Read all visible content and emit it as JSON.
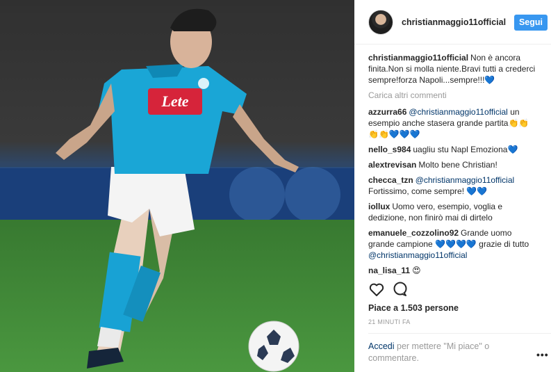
{
  "post": {
    "username": "christianmaggio11official",
    "follow_label": "Segui",
    "caption": {
      "user": "christianmaggio11official",
      "text": "Non è ancora finita.Non si molla niente.Bravi tutti a crederci sempre!forza Napoli...sempre!!!",
      "emoji": "💙"
    },
    "load_more": "Carica altri commenti",
    "comments": [
      {
        "user": "azzurra66",
        "mention": "@christianmaggio11official",
        "text": " un esempio anche stasera grande partita",
        "emoji": "👏👏👏👏💙💙💙"
      },
      {
        "user": "nello_s984",
        "mention": "",
        "text": "uagliu stu Napl Emoziona",
        "emoji": "💙"
      },
      {
        "user": "alextrevisan",
        "mention": "",
        "text": "Molto bene Christian!",
        "emoji": ""
      },
      {
        "user": "checca_tzn",
        "mention": "@christianmaggio11official",
        "text": " Fortissimo, come sempre! ",
        "emoji": "💙💙"
      },
      {
        "user": "iollux",
        "mention": "",
        "text": "Uomo vero, esempio, voglia e dedizione, non finirò mai di dirtelo",
        "emoji": ""
      },
      {
        "user": "emanuele_cozzolino92",
        "mention": "",
        "text": "Grande uomo grande campione ",
        "emoji": "💙💙💙💙",
        "text2": " grazie di tutto ",
        "mention2": "@christianmaggio11official"
      },
      {
        "user": "na_lisa_11",
        "mention": "",
        "text": "",
        "emoji": "😍"
      }
    ],
    "likes": "Piace a 1.503 persone",
    "time_ago": "21 MINUTI FA",
    "login_link": "Accedi",
    "login_text": " per mettere \"Mi piace\" o commentare.",
    "more_options": "•••"
  },
  "photo": {
    "sponsor": "Lete",
    "icons": [
      "like-icon",
      "comment-icon",
      "more-options-icon"
    ]
  }
}
